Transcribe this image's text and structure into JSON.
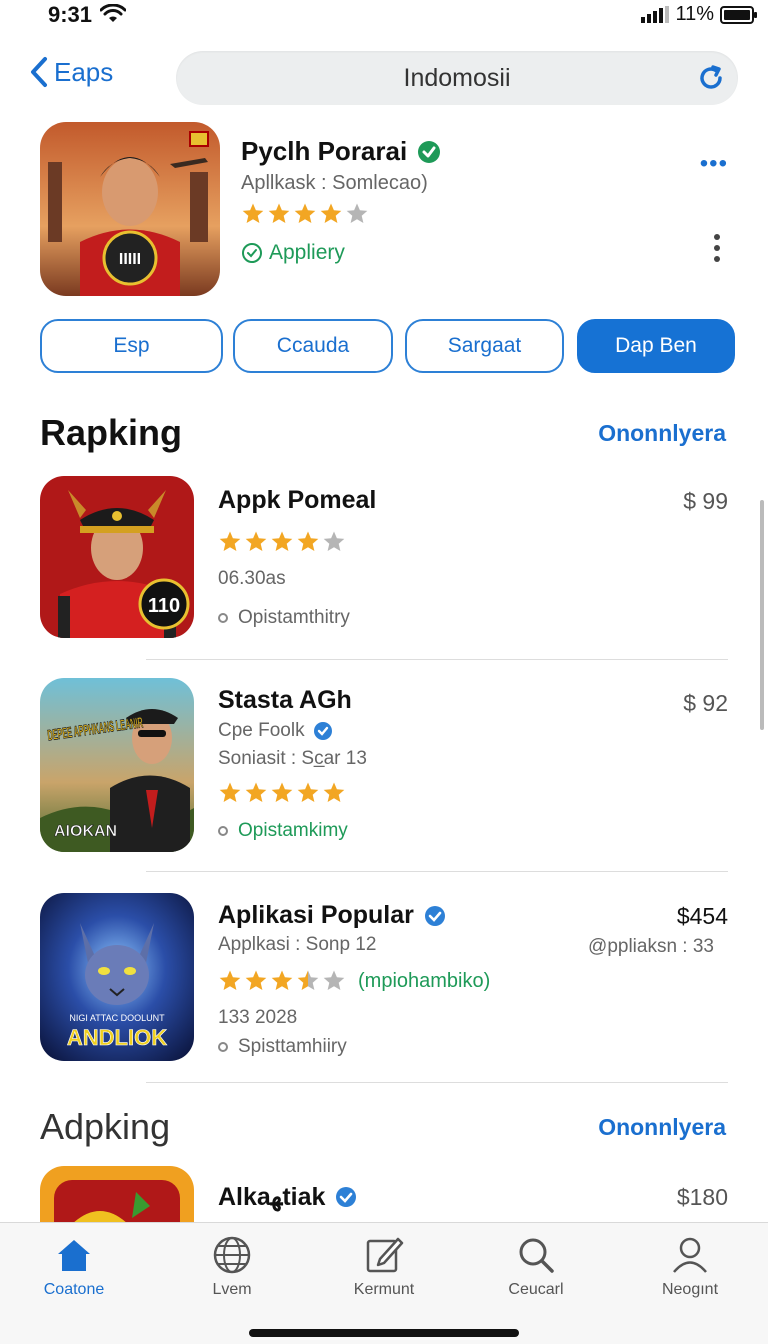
{
  "status_bar": {
    "time": "9:31",
    "battery": "11%"
  },
  "nav": {
    "back_label": "Eaps",
    "title": "Indomosii"
  },
  "hero": {
    "title": "Pyclh Porarai",
    "subtitle": "Apllkask : Somlecao)",
    "rating": 4,
    "status": "Appliery",
    "icon_caption": "ΙΙΙΙΙ"
  },
  "chips": [
    "Esp",
    "Ccauda",
    "Sargaat",
    "Dap Ben"
  ],
  "section1": {
    "title": "Rapking",
    "link": "Ononnlyera"
  },
  "apps": [
    {
      "title": "Appk Pomeal",
      "stars": 4,
      "line1": "06.30as",
      "line2": "Opistamthitry",
      "price": "$ 99",
      "badge": "110"
    },
    {
      "title": "Stasta AGh",
      "subtitle": "Cpe Foolk",
      "line1": "Soniasit : Sc̲ar 13",
      "stars": 5,
      "line2": "Opistamkimy",
      "price": "$ 92",
      "cover_top": "DEPEE APPHKANS LEANIR",
      "cover_bottom": "AIOKAN"
    },
    {
      "title": "Aplikasi Popular",
      "subtitle": "Applkasi : Sonp 12",
      "sub_right": "@ppliaksn : 33",
      "stars": 3.5,
      "stars_extra": "(mpiohambiko)",
      "line1": "133 2028",
      "line2": "Spisttamhiiry",
      "price": "$454",
      "cover_small": "NIGI ATTAC DOOLUNT",
      "cover_big": "ANDLIOK"
    }
  ],
  "section2": {
    "title": "Adpking",
    "link": "Ononnlyera"
  },
  "partial_app": {
    "title": "Alkaﻬtiak",
    "price": "$180"
  },
  "tabs": [
    {
      "label": "Coatone",
      "icon": "home-icon"
    },
    {
      "label": "Lvem",
      "icon": "globe-icon"
    },
    {
      "label": "Kermunt",
      "icon": "edit-icon"
    },
    {
      "label": "Ceucarl",
      "icon": "search-icon"
    },
    {
      "label": "Neogınt",
      "icon": "profile-icon"
    }
  ],
  "colors": {
    "accent": "#1672d4",
    "star": "#f2a623",
    "green": "#1e9a58"
  }
}
